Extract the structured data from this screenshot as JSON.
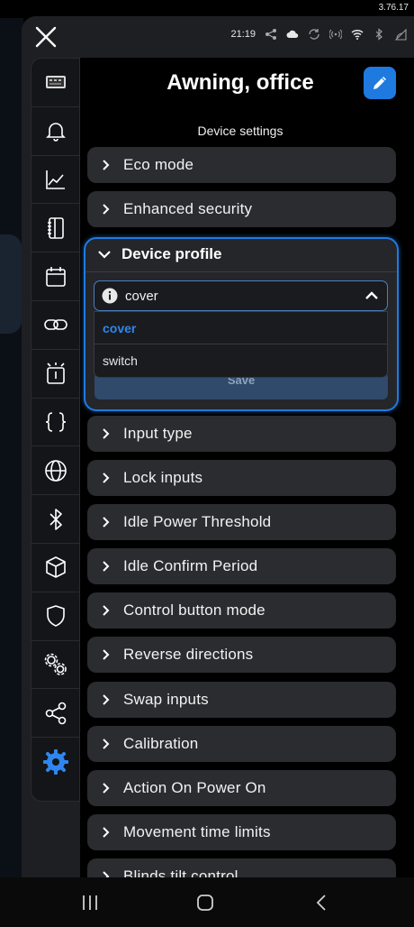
{
  "version": "3.76.17",
  "status": {
    "time": "21:19"
  },
  "page": {
    "title": "Awning, office",
    "subtitle": "Device settings"
  },
  "sidebar": {
    "items": [
      {
        "icon": "device-image-icon"
      },
      {
        "icon": "bell-icon"
      },
      {
        "icon": "chart-icon"
      },
      {
        "icon": "notebook-icon"
      },
      {
        "icon": "calendar-icon"
      },
      {
        "icon": "link-icon"
      },
      {
        "icon": "device-alarm-icon"
      },
      {
        "icon": "braces-icon"
      },
      {
        "icon": "globe-icon"
      },
      {
        "icon": "bluetooth-icon"
      },
      {
        "icon": "cube-icon"
      },
      {
        "icon": "shield-icon"
      },
      {
        "icon": "gears-icon"
      },
      {
        "icon": "share-icon"
      },
      {
        "icon": "settings-icon",
        "active": true
      }
    ]
  },
  "sections_top": [
    {
      "label": "Eco mode"
    },
    {
      "label": "Enhanced security"
    }
  ],
  "profile": {
    "label": "Device profile",
    "selected": "cover",
    "options": [
      "cover",
      "switch"
    ],
    "save_label": "Save"
  },
  "sections_bottom": [
    {
      "label": "Input type"
    },
    {
      "label": "Lock inputs"
    },
    {
      "label": "Idle Power Threshold"
    },
    {
      "label": "Idle Confirm Period"
    },
    {
      "label": "Control button mode"
    },
    {
      "label": "Reverse directions"
    },
    {
      "label": "Swap inputs"
    },
    {
      "label": "Calibration"
    },
    {
      "label": "Action On Power On"
    },
    {
      "label": "Movement time limits"
    },
    {
      "label": "Blinds tilt control"
    }
  ],
  "colors": {
    "accent": "#1f7ae0",
    "row_bg": "#2b2c30",
    "panel_bg": "#1e1f22"
  }
}
